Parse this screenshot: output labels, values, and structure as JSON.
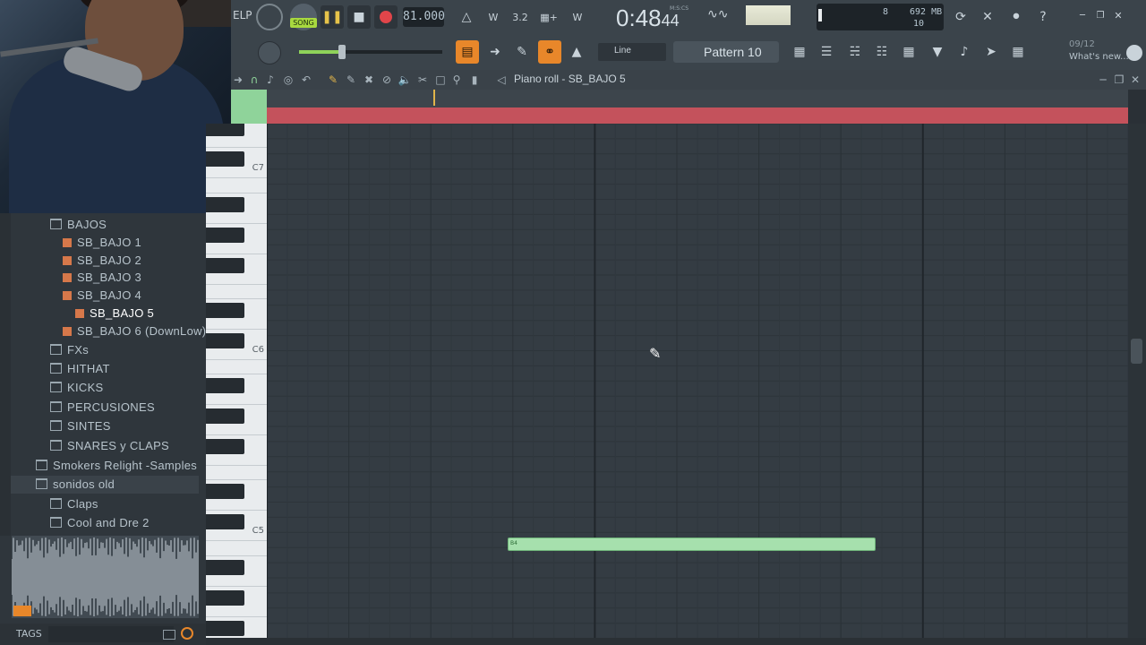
{
  "toolbar": {
    "help_label": "ELP",
    "song_label": "SONG",
    "tempo": "81.000",
    "time_display": "0:48",
    "time_ms": "44",
    "time_unit": "M:S:CS",
    "cpu_num": "8",
    "memory": "692 MB",
    "voices": "10",
    "snap_mode": "Line",
    "pattern_name": "Pattern 10",
    "news_date": "09/12",
    "news_label": "What's new..."
  },
  "piano_roll": {
    "title": "Piano roll - SB_BAJO 5",
    "octaves": [
      "C7",
      "C6",
      "C5"
    ],
    "note_label": "B4"
  },
  "browser": {
    "items": [
      {
        "label": "BAJOS",
        "kind": "folder",
        "indent": 1
      },
      {
        "label": "SB_BAJO 1",
        "kind": "pattern",
        "indent": 2
      },
      {
        "label": "SB_BAJO 2",
        "kind": "pattern",
        "indent": 2
      },
      {
        "label": "SB_BAJO 3",
        "kind": "pattern",
        "indent": 2
      },
      {
        "label": "SB_BAJO 4",
        "kind": "pattern",
        "indent": 2
      },
      {
        "label": "SB_BAJO 5",
        "kind": "pattern",
        "indent": 3,
        "selected": true
      },
      {
        "label": "SB_BAJO 6 (DownLow)",
        "kind": "pattern",
        "indent": 2
      },
      {
        "label": "FXs",
        "kind": "folder",
        "indent": 1
      },
      {
        "label": "HITHAT",
        "kind": "folder",
        "indent": 1
      },
      {
        "label": "KICKS",
        "kind": "folder",
        "indent": 1
      },
      {
        "label": "PERCUSIONES",
        "kind": "folder",
        "indent": 1
      },
      {
        "label": "SINTES",
        "kind": "folder",
        "indent": 1
      },
      {
        "label": "SNARES y CLAPS",
        "kind": "folder",
        "indent": 1
      },
      {
        "label": "Smokers Relight -Samples",
        "kind": "folder",
        "indent": 0
      },
      {
        "label": "sonidos old",
        "kind": "folder",
        "indent": 0,
        "highlight": true
      },
      {
        "label": "Claps",
        "kind": "folder",
        "indent": 1
      },
      {
        "label": "Cool and Dre 2",
        "kind": "folder",
        "indent": 1
      }
    ],
    "tags_label": "TAGS"
  },
  "colors": {
    "accent_note": "#a6e0ad",
    "loop_bar": "#c4525c",
    "panel": "#3b444b"
  }
}
